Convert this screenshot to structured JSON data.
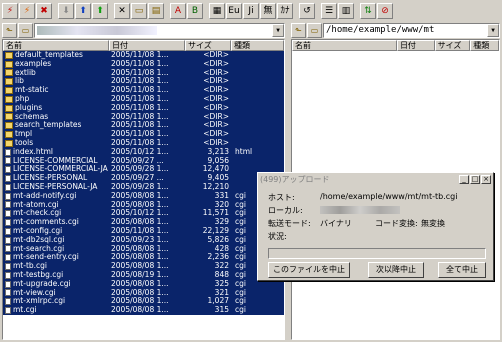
{
  "toolbar": {
    "buttons": [
      {
        "name": "connect-icon",
        "glyph": "⚡",
        "color": "#c00000"
      },
      {
        "name": "quick-connect-icon",
        "glyph": "⚡",
        "color": "#e06000"
      },
      {
        "name": "disconnect-icon",
        "glyph": "✖",
        "color": "#c00000"
      },
      {
        "name": "download-icon",
        "glyph": "⬇",
        "color": "#8a8a8a"
      },
      {
        "name": "upload-icon",
        "glyph": "⬆",
        "color": "#1040c0"
      },
      {
        "name": "mirror-icon",
        "glyph": "⬆",
        "color": "#10a010"
      },
      {
        "name": "delete-icon",
        "glyph": "✕",
        "color": "#000000"
      },
      {
        "name": "rename-icon",
        "glyph": "▭",
        "color": "#806000"
      },
      {
        "name": "mkdir-icon",
        "glyph": "▤",
        "color": "#806000"
      },
      {
        "name": "ascii-mode-icon",
        "glyph": "A",
        "color": "#c00000"
      },
      {
        "name": "binary-mode-icon",
        "glyph": "B",
        "color": "#006000"
      },
      {
        "name": "auto-mode-icon",
        "glyph": "▦",
        "color": "#000000"
      },
      {
        "name": "euc-icon",
        "glyph": "Eu",
        "color": "#000000"
      },
      {
        "name": "jis-icon",
        "glyph": "Ji",
        "color": "#000000"
      },
      {
        "name": "no-convert-icon",
        "glyph": "無",
        "color": "#000000"
      },
      {
        "name": "kana-icon",
        "glyph": "ｶﾅ",
        "color": "#000000"
      },
      {
        "name": "refresh-icon",
        "glyph": "↺",
        "color": "#000000"
      },
      {
        "name": "list-view-icon",
        "glyph": "☰",
        "color": "#000000"
      },
      {
        "name": "detail-view-icon",
        "glyph": "▥",
        "color": "#000000"
      },
      {
        "name": "sync-icon",
        "glyph": "⇅",
        "color": "#108010"
      },
      {
        "name": "stop-icon",
        "glyph": "⊘",
        "color": "#c00000"
      }
    ]
  },
  "local_pane": {
    "path": "",
    "headers": {
      "name": "名前",
      "date": "日付",
      "size": "サイズ",
      "type": "種類"
    },
    "rows": [
      {
        "name": "default_templates",
        "date": "2005/11/08 1...",
        "size": "<DIR>",
        "type": "",
        "kind": "folder"
      },
      {
        "name": "examples",
        "date": "2005/11/08 1...",
        "size": "<DIR>",
        "type": "",
        "kind": "folder"
      },
      {
        "name": "extlib",
        "date": "2005/11/08 1...",
        "size": "<DIR>",
        "type": "",
        "kind": "folder"
      },
      {
        "name": "lib",
        "date": "2005/11/08 1...",
        "size": "<DIR>",
        "type": "",
        "kind": "folder"
      },
      {
        "name": "mt-static",
        "date": "2005/11/08 1...",
        "size": "<DIR>",
        "type": "",
        "kind": "folder"
      },
      {
        "name": "php",
        "date": "2005/11/08 1...",
        "size": "<DIR>",
        "type": "",
        "kind": "folder"
      },
      {
        "name": "plugins",
        "date": "2005/11/08 1...",
        "size": "<DIR>",
        "type": "",
        "kind": "folder"
      },
      {
        "name": "schemas",
        "date": "2005/11/08 1...",
        "size": "<DIR>",
        "type": "",
        "kind": "folder"
      },
      {
        "name": "search_templates",
        "date": "2005/11/08 1...",
        "size": "<DIR>",
        "type": "",
        "kind": "folder"
      },
      {
        "name": "tmpl",
        "date": "2005/11/08 1...",
        "size": "<DIR>",
        "type": "",
        "kind": "folder"
      },
      {
        "name": "tools",
        "date": "2005/11/08 1...",
        "size": "<DIR>",
        "type": "",
        "kind": "folder"
      },
      {
        "name": "index.html",
        "date": "2005/10/12 1...",
        "size": "3,213",
        "type": "html",
        "kind": "file"
      },
      {
        "name": "LICENSE-COMMERCIAL",
        "date": "2005/09/27 ...",
        "size": "9,056",
        "type": "",
        "kind": "file"
      },
      {
        "name": "LICENSE-COMMERCIAL-JA",
        "date": "2005/09/28 1...",
        "size": "12,470",
        "type": "",
        "kind": "file"
      },
      {
        "name": "LICENSE-PERSONAL",
        "date": "2005/09/27 ...",
        "size": "9,405",
        "type": "",
        "kind": "file"
      },
      {
        "name": "LICENSE-PERSONAL-JA",
        "date": "2005/09/28 1...",
        "size": "12,210",
        "type": "",
        "kind": "file"
      },
      {
        "name": "mt-add-notify.cgi",
        "date": "2005/08/08 1...",
        "size": "331",
        "type": "cgi",
        "kind": "file"
      },
      {
        "name": "mt-atom.cgi",
        "date": "2005/08/08 1...",
        "size": "320",
        "type": "cgi",
        "kind": "file"
      },
      {
        "name": "mt-check.cgi",
        "date": "2005/10/12 1...",
        "size": "11,571",
        "type": "cgi",
        "kind": "file"
      },
      {
        "name": "mt-comments.cgi",
        "date": "2005/08/08 1...",
        "size": "329",
        "type": "cgi",
        "kind": "file"
      },
      {
        "name": "mt-config.cgi",
        "date": "2005/11/08 1...",
        "size": "22,129",
        "type": "cgi",
        "kind": "file"
      },
      {
        "name": "mt-db2sql.cgi",
        "date": "2005/09/23 1...",
        "size": "5,826",
        "type": "cgi",
        "kind": "file"
      },
      {
        "name": "mt-search.cgi",
        "date": "2005/08/08 1...",
        "size": "428",
        "type": "cgi",
        "kind": "file"
      },
      {
        "name": "mt-send-entry.cgi",
        "date": "2005/08/08 1...",
        "size": "2,236",
        "type": "cgi",
        "kind": "file"
      },
      {
        "name": "mt-tb.cgi",
        "date": "2005/08/08 1...",
        "size": "322",
        "type": "cgi",
        "kind": "file"
      },
      {
        "name": "mt-testbg.cgi",
        "date": "2005/08/19 1...",
        "size": "848",
        "type": "cgi",
        "kind": "file"
      },
      {
        "name": "mt-upgrade.cgi",
        "date": "2005/08/08 1...",
        "size": "325",
        "type": "cgi",
        "kind": "file"
      },
      {
        "name": "mt-view.cgi",
        "date": "2005/08/08 1...",
        "size": "321",
        "type": "cgi",
        "kind": "file"
      },
      {
        "name": "mt-xmlrpc.cgi",
        "date": "2005/08/08 1...",
        "size": "1,027",
        "type": "cgi",
        "kind": "file"
      },
      {
        "name": "mt.cgi",
        "date": "2005/08/08 1...",
        "size": "315",
        "type": "cgi",
        "kind": "file"
      }
    ]
  },
  "remote_pane": {
    "path": "/home/example/www/mt",
    "headers": {
      "name": "名前",
      "date": "日付",
      "size": "サイズ",
      "type": "種類"
    }
  },
  "dialog": {
    "title": "(499)アップロード",
    "host_label": "ホスト:",
    "host_value": "/home/example/www/mt/mt-tb.cgi",
    "local_label": "ローカル:",
    "mode_label": "転送モード:",
    "mode_value": "バイナリ",
    "code_label": "コード変換:",
    "code_value": "無変換",
    "status_label": "状況:",
    "progress": 0,
    "btn_skip": "このファイルを中止",
    "btn_next": "次以降中止",
    "btn_all": "全て中止"
  },
  "colors": {
    "selection": "#0a246a",
    "face": "#d4d0c8"
  }
}
